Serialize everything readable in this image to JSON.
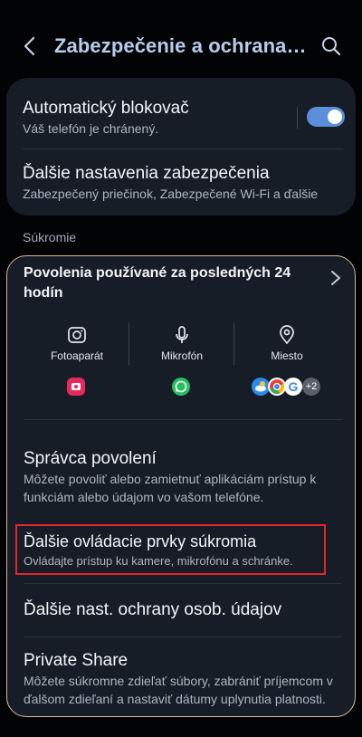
{
  "header": {
    "title": "Zabezpečenie a ochrana o..."
  },
  "security_card": {
    "auto_blocker_title": "Automatický blokovač",
    "auto_blocker_subtitle": "Váš telefón je chránený.",
    "auto_blocker_enabled": true,
    "more_security_title": "Ďalšie nastavenia zabezpečenia",
    "more_security_subtitle": "Zabezpečený priečinok, Zabezpečené Wi-Fi a ďalšie"
  },
  "privacy": {
    "section_label": "Súkromie",
    "recent_permissions_title": "Povolenia používané za posledných 24 hodín",
    "columns": [
      {
        "label": "Fotoaparát",
        "icon": "camera-icon"
      },
      {
        "label": "Mikrofón",
        "icon": "microphone-icon"
      },
      {
        "label": "Miesto",
        "icon": "location-pin-icon"
      }
    ],
    "more_apps_badge": "+2",
    "items": [
      {
        "title": "Správca povolení",
        "subtitle": "Môžete povoliť alebo zamietnuť aplikáciám prístup k funkciám alebo údajom vo vašom telefóne."
      },
      {
        "title": "Ďalšie ovládacie prvky súkromia",
        "subtitle": "Ovládajte prístup ku kamere, mikrofónu a schránke."
      },
      {
        "title": "Ďalšie nast. ochrany osob. údajov",
        "subtitle": ""
      },
      {
        "title": "Private Share",
        "subtitle": "Môžete súkromne zdieľať súbory, zabrániť príjemcom v ďalšom zdieľaní a nastaviť dátumy uplynutia platnosti."
      }
    ]
  },
  "colors": {
    "accent": "#5b8fd9",
    "title": "#b8cdee",
    "card": "#171d27",
    "highlight": "#e3262c"
  }
}
